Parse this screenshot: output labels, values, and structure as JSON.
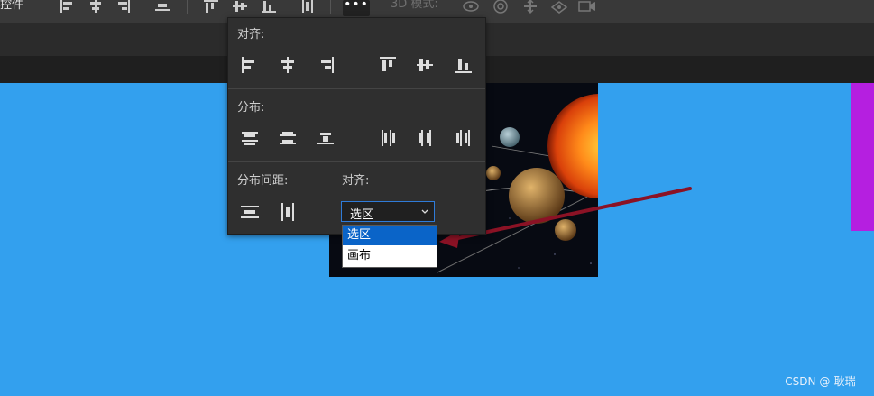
{
  "toolbar": {
    "left_text": "控件",
    "more_label": "•••",
    "mode_label": "3D 模式:"
  },
  "panel": {
    "align_title": "对齐:",
    "distribute_title": "分布:",
    "distribute_spacing_title": "分布间距:",
    "align_to_title": "对齐:",
    "align_to_value": "选区"
  },
  "dropdown": {
    "options": [
      "选区",
      "画布"
    ],
    "selected_index": 0
  },
  "watermark": "CSDN @-耿瑞-",
  "colors": {
    "canvas_bg": "#33a0ee",
    "panel_bg": "#2f2f2f",
    "select_border": "#2f7bd8",
    "selected_option": "#0a64c8",
    "arrow": "#8b1225",
    "purple_layer": "#b51fe0"
  },
  "icons": [
    "align-left-edges-icon",
    "align-horizontal-centers-icon",
    "align-right-edges-icon",
    "align-top-edges-icon",
    "align-vertical-centers-icon",
    "align-bottom-edges-icon",
    "distribute-top-icon",
    "distribute-vertical-centers-icon",
    "distribute-bottom-icon",
    "distribute-left-icon",
    "distribute-horizontal-centers-icon",
    "distribute-right-icon",
    "distribute-vertical-spacing-icon",
    "distribute-horizontal-spacing-icon",
    "chevron-down-icon"
  ]
}
